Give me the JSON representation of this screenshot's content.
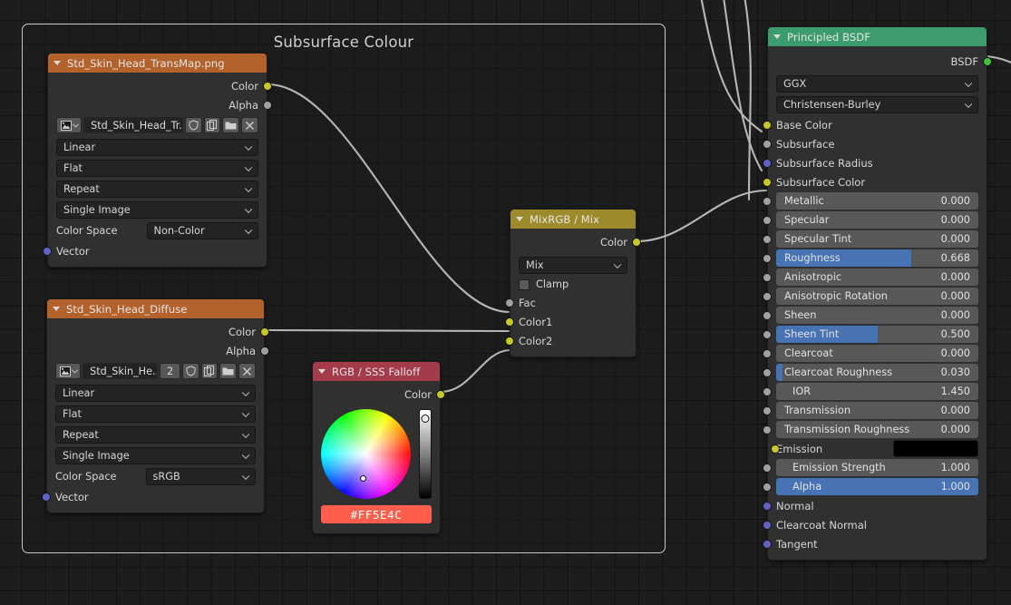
{
  "editor": {
    "background": "#1d1d1d",
    "grid_color": "#141414"
  },
  "frame": {
    "label": "Subsurface Colour",
    "border_color": "#c8c8c8"
  },
  "socket_colors": {
    "color": "#c7c729",
    "value": "#a1a1a1",
    "vector": "#6363c7",
    "shader": "#3ec23e"
  },
  "nodes": {
    "transmap": {
      "title": "Std_Skin_Head_TransMap.png",
      "header_color": "#b4622c",
      "outputs": [
        {
          "label": "Color",
          "socket": "color"
        },
        {
          "label": "Alpha",
          "socket": "value"
        }
      ],
      "image_row": {
        "type_icon": "image-datablock-icon",
        "name": "Std_Skin_Head_Tr...",
        "users": "",
        "fake_user_icon": "shield-icon",
        "new_icon": "copy-icon",
        "open_icon": "folder-icon",
        "unlink_icon": "x-icon"
      },
      "dropdowns": [
        "Linear",
        "Flat",
        "Repeat",
        "Single Image"
      ],
      "color_space": {
        "label": "Color Space",
        "value": "Non-Color"
      },
      "inputs": [
        {
          "label": "Vector",
          "socket": "vector"
        }
      ]
    },
    "diffuse": {
      "title": "Std_Skin_Head_Diffuse",
      "header_color": "#b4622c",
      "outputs": [
        {
          "label": "Color",
          "socket": "color"
        },
        {
          "label": "Alpha",
          "socket": "value"
        }
      ],
      "image_row": {
        "type_icon": "image-datablock-icon",
        "name": "Std_Skin_He...",
        "users": "2",
        "fake_user_icon": "shield-icon",
        "new_icon": "copy-icon",
        "open_icon": "folder-icon",
        "unlink_icon": "x-icon"
      },
      "dropdowns": [
        "Linear",
        "Flat",
        "Repeat",
        "Single Image"
      ],
      "color_space": {
        "label": "Color Space",
        "value": "sRGB"
      },
      "inputs": [
        {
          "label": "Vector",
          "socket": "vector"
        }
      ]
    },
    "rgb": {
      "title": "RGB / SSS Falloff",
      "header_color": "#a33b4b",
      "outputs": [
        {
          "label": "Color",
          "socket": "color"
        }
      ],
      "hex": "#FF5E4C",
      "swatch_color": "#ff5e4c"
    },
    "mixrgb": {
      "title": "MixRGB / Mix",
      "header_color": "#9d8b2b",
      "outputs": [
        {
          "label": "Color",
          "socket": "color"
        }
      ],
      "blend_mode": "Mix",
      "clamp_label": "Clamp",
      "clamp_checked": false,
      "inputs": [
        {
          "label": "Fac",
          "socket": "value"
        },
        {
          "label": "Color1",
          "socket": "color"
        },
        {
          "label": "Color2",
          "socket": "color"
        }
      ]
    },
    "principled": {
      "title": "Principled BSDF",
      "header_color": "#3c9c6e",
      "outputs": [
        {
          "label": "BSDF",
          "socket": "shader"
        }
      ],
      "distribution": "GGX",
      "subsurface_method": "Christensen-Burley",
      "socket_inputs": [
        {
          "label": "Base Color",
          "socket": "color"
        },
        {
          "label": "Subsurface",
          "socket": "value"
        },
        {
          "label": "Subsurface Radius",
          "socket": "vector"
        },
        {
          "label": "Subsurface Color",
          "socket": "color"
        }
      ],
      "values": [
        {
          "label": "Metallic",
          "value": "0.000",
          "fill": 0.0,
          "highlight": false,
          "indent": false
        },
        {
          "label": "Specular",
          "value": "0.000",
          "fill": 0.0,
          "highlight": false,
          "indent": false
        },
        {
          "label": "Specular Tint",
          "value": "0.000",
          "fill": 0.0,
          "highlight": false,
          "indent": false
        },
        {
          "label": "Roughness",
          "value": "0.668",
          "fill": 0.668,
          "highlight": true,
          "indent": false
        },
        {
          "label": "Anisotropic",
          "value": "0.000",
          "fill": 0.0,
          "highlight": false,
          "indent": false
        },
        {
          "label": "Anisotropic Rotation",
          "value": "0.000",
          "fill": 0.0,
          "highlight": false,
          "indent": false
        },
        {
          "label": "Sheen",
          "value": "0.000",
          "fill": 0.0,
          "highlight": false,
          "indent": false
        },
        {
          "label": "Sheen Tint",
          "value": "0.500",
          "fill": 0.5,
          "highlight": true,
          "indent": false
        },
        {
          "label": "Clearcoat",
          "value": "0.000",
          "fill": 0.0,
          "highlight": false,
          "indent": false
        },
        {
          "label": "Clearcoat Roughness",
          "value": "0.030",
          "fill": 0.03,
          "highlight": true,
          "indent": false
        },
        {
          "label": "IOR",
          "value": "1.450",
          "fill": 0.0,
          "highlight": false,
          "indent": true
        },
        {
          "label": "Transmission",
          "value": "0.000",
          "fill": 0.0,
          "highlight": false,
          "indent": false
        },
        {
          "label": "Transmission Roughness",
          "value": "0.000",
          "fill": 0.0,
          "highlight": false,
          "indent": false
        }
      ],
      "emission": {
        "label": "Emission",
        "swatch_color": "#000000",
        "socket": "color"
      },
      "post_values": [
        {
          "label": "Emission Strength",
          "value": "1.000",
          "fill": 0.0,
          "highlight": false,
          "indent": true
        },
        {
          "label": "Alpha",
          "value": "1.000",
          "fill": 1.0,
          "highlight": true,
          "indent": true
        }
      ],
      "tail_inputs": [
        {
          "label": "Normal",
          "socket": "vector"
        },
        {
          "label": "Clearcoat Normal",
          "socket": "vector"
        },
        {
          "label": "Tangent",
          "socket": "vector"
        }
      ],
      "accent_highlight": "#4772b3"
    }
  }
}
